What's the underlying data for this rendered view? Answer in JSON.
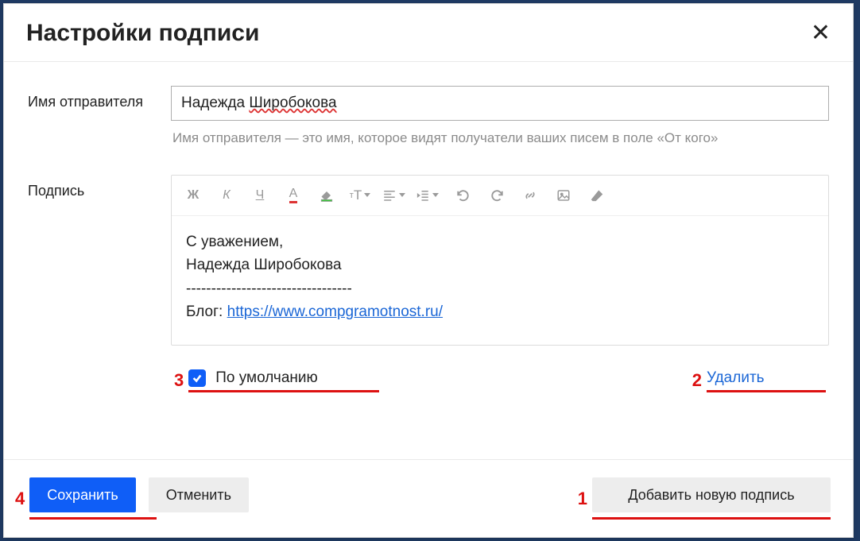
{
  "modal": {
    "title": "Настройки подписи"
  },
  "sender": {
    "label": "Имя отправителя",
    "value_first": "Надежда",
    "value_last": "Широбокова",
    "hint": "Имя отправителя — это имя, которое видят получатели ваших писем в поле «От кого»"
  },
  "signature": {
    "label": "Подпись",
    "line1": "С уважением,",
    "line2": "Надежда Широбокова",
    "divider": "---------------------------------",
    "blog_label": "Блог:",
    "blog_url": "https://www.compgramotnost.ru/"
  },
  "default_checkbox": {
    "checked": true,
    "label": "По умолчанию"
  },
  "delete_link": "Удалить",
  "footer": {
    "save": "Сохранить",
    "cancel": "Отменить",
    "add_new": "Добавить новую подпись"
  },
  "annotations": {
    "n1": "1",
    "n2": "2",
    "n3": "3",
    "n4": "4"
  },
  "toolbar_icons": {
    "bold": "Ж",
    "italic": "К",
    "underline": "Ч",
    "text_color": "A",
    "bg_color": "bg",
    "font_size": "тТ",
    "align": "align",
    "indent": "indent",
    "undo": "undo",
    "redo": "redo",
    "link": "link",
    "image": "image",
    "erase": "erase"
  }
}
